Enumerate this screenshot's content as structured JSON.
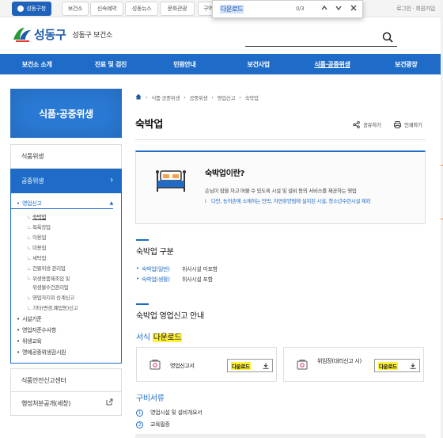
{
  "top_tabs": [
    {
      "label": "성동구청",
      "active": true
    },
    {
      "label": "보건소",
      "active": false
    },
    {
      "label": "신속예약",
      "active": false
    },
    {
      "label": "성동뉴스",
      "active": false
    },
    {
      "label": "문화관광",
      "active": false
    },
    {
      "label": "구역",
      "active": false
    }
  ],
  "top_links": {
    "login": "로그인",
    "sep": "·",
    "join": "회원가입"
  },
  "find_bar": {
    "query": "다운로드",
    "count": "0/3"
  },
  "header": {
    "brand": "성동구",
    "site_name": "성동구 보건소"
  },
  "gnb": [
    {
      "label": "보건소 소개",
      "active": false
    },
    {
      "label": "진료 및 검진",
      "active": false
    },
    {
      "label": "민원안내",
      "active": false
    },
    {
      "label": "보건사업",
      "active": false
    },
    {
      "label": "식품·공중위생",
      "active": true
    },
    {
      "label": "보건광장",
      "active": false
    }
  ],
  "lnb": {
    "title": "식품·공중위생",
    "top_item": "식품위생",
    "active_item": "공중위생",
    "sub": {
      "group1": "영업신고",
      "group1_items": [
        "숙박업",
        "목욕장업",
        "이용업",
        "미용업",
        "세탁업",
        "건물위생 관리업"
      ],
      "two_line_item": [
        "위생용품제조업 및",
        "위생물수건관리업"
      ],
      "group1_items_after": [
        "영업자지위 승계신고",
        "기타(변경,폐업등)신고"
      ],
      "groups": [
        "시설기준",
        "영업자준수사항",
        "위생교육",
        "명예공중위생감시원"
      ]
    },
    "items_after": [
      "식품안전신고센터",
      "행정처분공개(세창)"
    ]
  },
  "breadcrumb": [
    "식품·공중위생",
    "공중위생",
    "영업신고",
    "숙박업"
  ],
  "page_title": "숙박업",
  "tools": {
    "share": "공유하기",
    "print": "인쇄하기"
  },
  "info": {
    "title": "숙박업이란?",
    "desc": "손님이 잠을 자고 머물 수 있도록 시설 및 설비 등의 서비스를 제공하는 영업",
    "note": "다만, 농어촌에 소재하는 민박, 자연휴양림에 설치된 시설, 청소년수련시설 제외"
  },
  "section1": {
    "title": "숙박업 구분",
    "rows": [
      {
        "key": "숙박업(일반)",
        "value": "취사시설 미포함"
      },
      {
        "key": "숙박업(생활)",
        "value": "취사시설 포함"
      }
    ]
  },
  "section2": {
    "title": "숙박업 영업신고 안내",
    "forms_heading": "서식",
    "forms_heading_hl": "다운로드",
    "cards": [
      {
        "name": "영업신고서",
        "button": "다운로드"
      },
      {
        "name": "위임장(대리신고 시)",
        "button": "다운로드"
      }
    ],
    "docs_heading": "구비서류",
    "docs": [
      {
        "num": "1",
        "text": "영업시설 및 설비개요서"
      },
      {
        "num": "2",
        "text": "교육필증"
      }
    ]
  },
  "colors": {
    "primary": "#1e6cc8",
    "highlight": "#fff23b"
  }
}
